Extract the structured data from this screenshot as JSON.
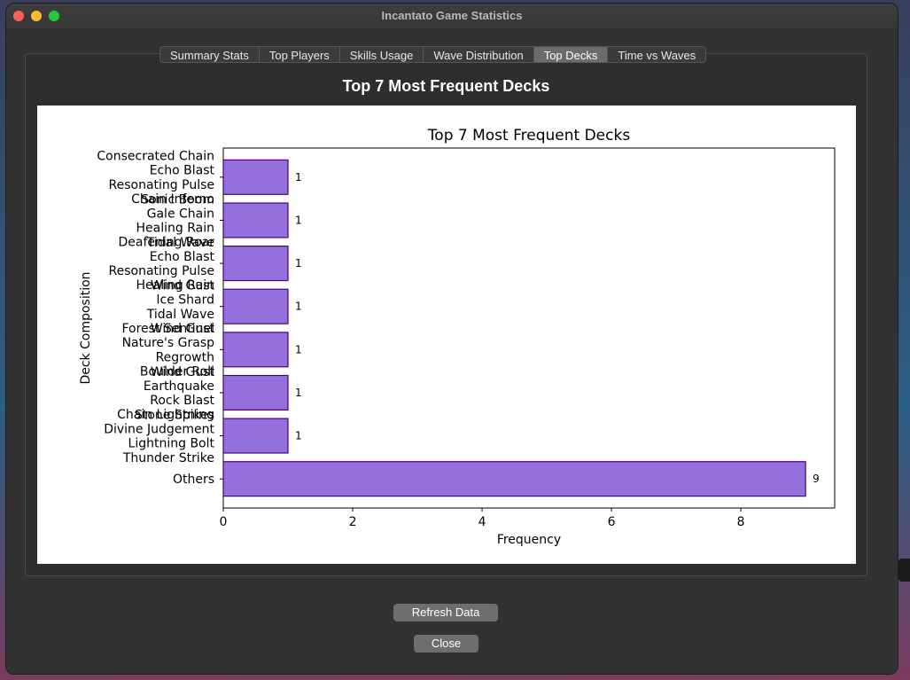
{
  "window": {
    "title": "Incantato Game Statistics"
  },
  "tabs": [
    {
      "label": "Summary Stats",
      "active": false
    },
    {
      "label": "Top Players",
      "active": false
    },
    {
      "label": "Skills Usage",
      "active": false
    },
    {
      "label": "Wave Distribution",
      "active": false
    },
    {
      "label": "Top Decks",
      "active": true
    },
    {
      "label": "Time vs Waves",
      "active": false
    }
  ],
  "page": {
    "title": "Top 7 Most Frequent Decks"
  },
  "buttons": {
    "refresh": "Refresh Data",
    "close": "Close"
  },
  "chart_data": {
    "type": "bar",
    "orientation": "horizontal",
    "title": "Top 7 Most Frequent Decks",
    "xlabel": "Frequency",
    "ylabel": "Deck Composition",
    "xlim": [
      0,
      9.45
    ],
    "xticks": [
      0,
      2,
      4,
      6,
      8
    ],
    "bar_color": "#9370db",
    "bar_edge_color": "#4b0082",
    "categories": [
      [
        "Consecrated Chain",
        "Echo Blast",
        "Resonating Pulse",
        "Sonic Boom"
      ],
      [
        "Chain Inferno",
        "Gale Chain",
        "Healing Rain",
        "Tidal Wave"
      ],
      [
        "Deafening Roar",
        "Echo Blast",
        "Resonating Pulse",
        "Wind Gust"
      ],
      [
        "Healing Rain",
        "Ice Shard",
        "Tidal Wave",
        "Wind Gust"
      ],
      [
        "Forest Sentinel",
        "Nature's Grasp",
        "Regrowth",
        "Wind Gust"
      ],
      [
        "Boulder Roll",
        "Earthquake",
        "Rock Blast",
        "Stone Spikes"
      ],
      [
        "Chain Lightning",
        "Divine Judgement",
        "Lightning Bolt",
        "Thunder Strike"
      ],
      [
        "Others"
      ]
    ],
    "values": [
      1,
      1,
      1,
      1,
      1,
      1,
      1,
      9
    ]
  }
}
